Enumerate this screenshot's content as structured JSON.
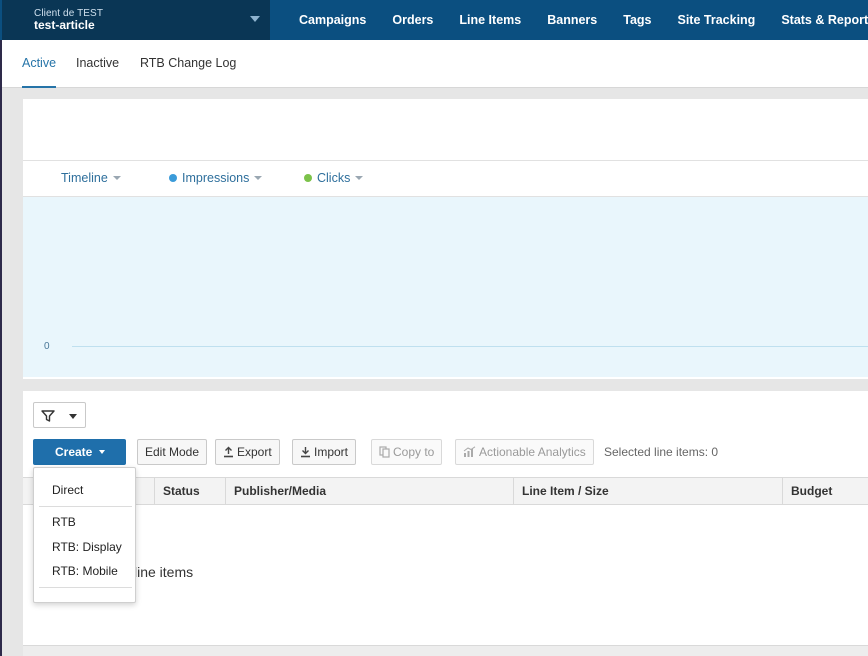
{
  "client": {
    "label": "Client de TEST",
    "name": "test-article"
  },
  "nav": {
    "items": [
      {
        "label": "Campaigns"
      },
      {
        "label": "Orders"
      },
      {
        "label": "Line Items"
      },
      {
        "label": "Banners"
      },
      {
        "label": "Tags"
      },
      {
        "label": "Site Tracking"
      },
      {
        "label": "Stats & Reports"
      }
    ]
  },
  "subtabs": [
    {
      "label": "Active",
      "active": true
    },
    {
      "label": "Inactive",
      "active": false
    },
    {
      "label": "RTB Change Log",
      "active": false
    }
  ],
  "chart_controls": {
    "timeline": "Timeline",
    "impressions": "Impressions",
    "clicks": "Clicks"
  },
  "colors": {
    "nav_bg": "#0b4f80",
    "client_bg": "#0a3655",
    "accent": "#2674a8",
    "impressions_dot": "#3b9bd9",
    "clicks_dot": "#7cc24a",
    "plot_bg": "#e9f6fc",
    "create_button": "#1f6fab"
  },
  "chart_data": {
    "type": "line",
    "title": "",
    "xlabel": "",
    "ylabel": "",
    "y_ticks": [
      "0"
    ],
    "series": [],
    "grid": false
  },
  "toolbar": {
    "create_label": "Create",
    "edit_mode_label": "Edit Mode",
    "export_label": "Export",
    "import_label": "Import",
    "copy_to_label": "Copy to",
    "analytics_label": "Actionable Analytics",
    "selected_count": "Selected line items: 0",
    "filter_icon": "funnel-icon"
  },
  "create_menu": {
    "items": [
      {
        "label": "Direct"
      },
      {
        "label": "RTB"
      },
      {
        "label": "RTB: Display"
      },
      {
        "label": "RTB: Mobile"
      }
    ]
  },
  "table": {
    "columns": [
      "Status",
      "Publisher/Media",
      "Line Item / Size",
      "Budget"
    ],
    "empty_message": "line items"
  }
}
